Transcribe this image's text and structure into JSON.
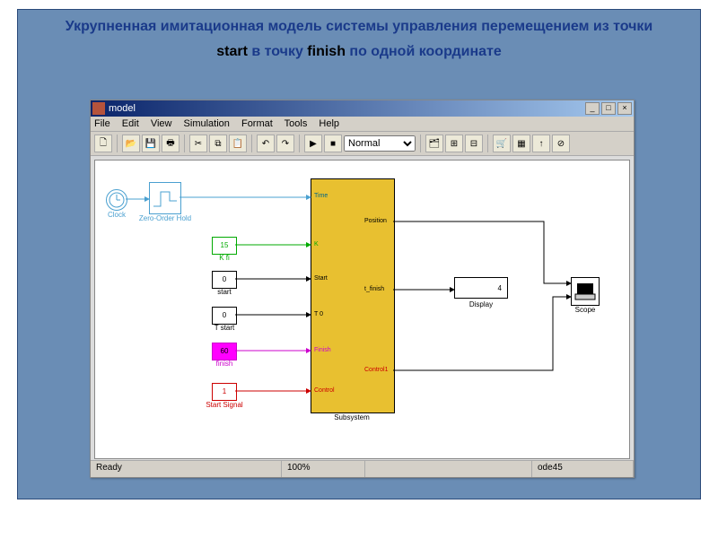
{
  "caption": {
    "line1": "Укрупненная имитационная модель системы управления перемещением из точки",
    "line2_pre": "start",
    "line2_mid": " в точку ",
    "line2_post": "finish",
    "line2_tail": " по одной координате"
  },
  "window": {
    "title": "model",
    "btn_min": "_",
    "btn_max": "□",
    "btn_close": "×"
  },
  "menu": {
    "file": "File",
    "edit": "Edit",
    "view": "View",
    "simulation": "Simulation",
    "format": "Format",
    "tools": "Tools",
    "help": "Help"
  },
  "toolbar": {
    "mode": "Normal",
    "new": "🗋",
    "open": "📂",
    "save": "💾",
    "print": "🖶",
    "cut": "✂",
    "copy": "⧉",
    "paste": "📋",
    "undo": "↶",
    "redo": "↷",
    "play": "▶",
    "stop": "■",
    "lib1": "🗂",
    "lib2": "⊞",
    "lib3": "⊟",
    "lib4": "🛒",
    "lib5": "▦",
    "lib6": "↑",
    "lib7": "⊘"
  },
  "status": {
    "ready": "Ready",
    "zoom": "100%",
    "solver": "ode45"
  },
  "blocks": {
    "clock": {
      "label": "Clock"
    },
    "zoh": {
      "label": "Zero-Order Hold"
    },
    "kfi": {
      "value": "15",
      "label": "K fi"
    },
    "start_const": {
      "value": "0",
      "label": "start"
    },
    "tstart": {
      "value": "0",
      "label": "T start"
    },
    "finish_const": {
      "value": "60",
      "label": "finish"
    },
    "start_signal": {
      "value": "1",
      "label": "Start Signal"
    },
    "subsystem": {
      "label": "Subsystem"
    },
    "display": {
      "value": "4",
      "label": "Display"
    },
    "scope": {
      "label": "Scope"
    }
  },
  "ports": {
    "time": "Time",
    "k": "K",
    "start": "Start",
    "t0": "T 0",
    "finish": "Finish",
    "control": "Control",
    "position": "Position",
    "t_finish": "t_finish",
    "control1": "Control1"
  }
}
